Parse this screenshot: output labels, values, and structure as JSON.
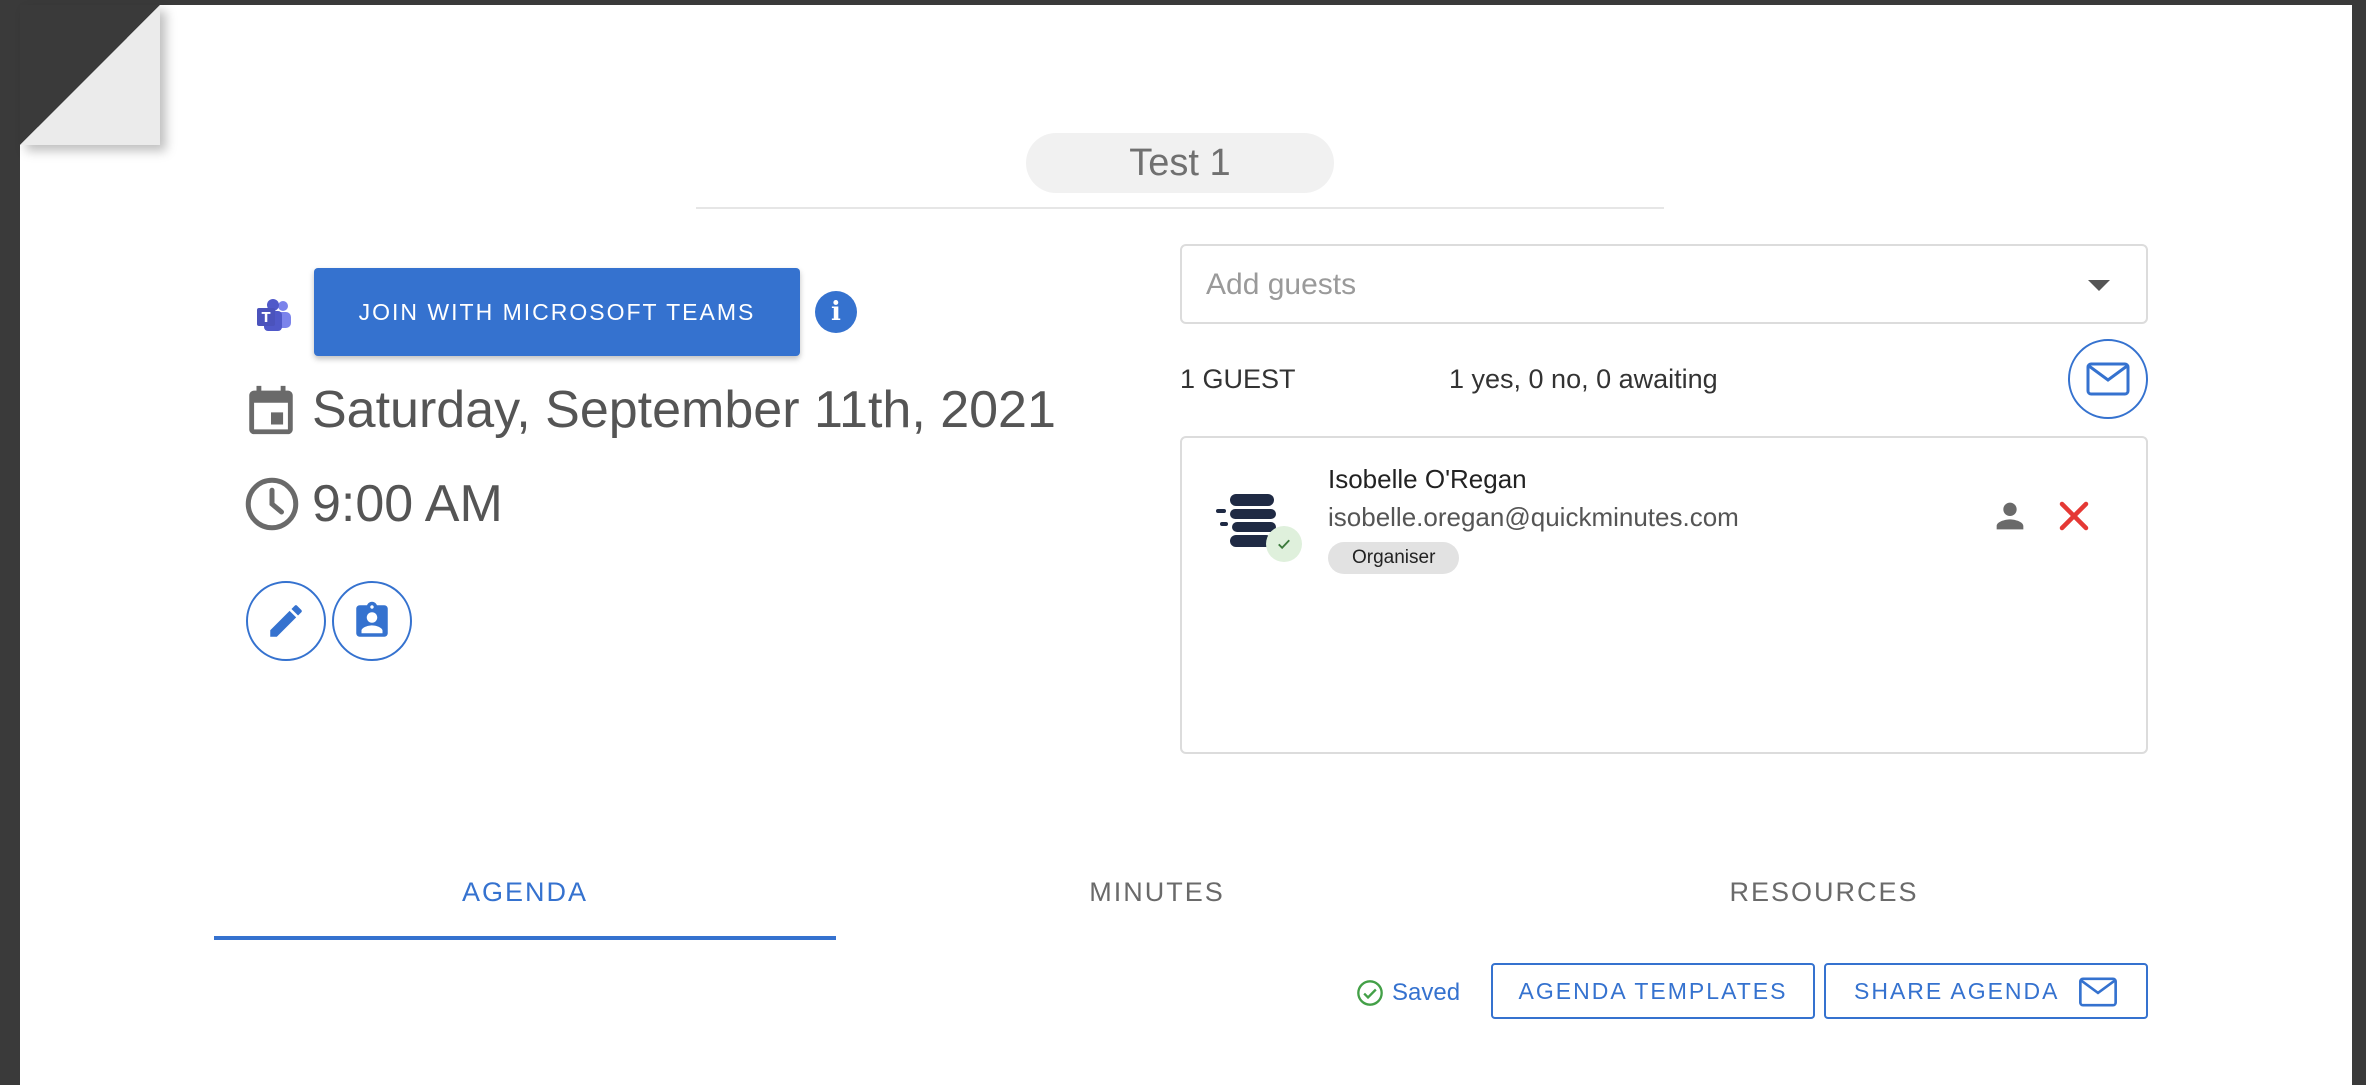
{
  "meeting": {
    "title": "Test 1",
    "join_label": "JOIN WITH MICROSOFT TEAMS",
    "date": "Saturday, September 11th, 2021",
    "time": "9:00 AM"
  },
  "guests": {
    "placeholder": "Add guests",
    "count_label": "1 GUEST",
    "summary": "1 yes, 0 no, 0 awaiting",
    "list": [
      {
        "name": "Isobelle O'Regan",
        "email": "isobelle.oregan@quickminutes.com",
        "role": "Organiser"
      }
    ]
  },
  "tabs": {
    "agenda": "AGENDA",
    "minutes": "MINUTES",
    "resources": "RESOURCES"
  },
  "toolbar": {
    "saved": "Saved",
    "agenda_templates": "AGENDA TEMPLATES",
    "share_agenda": "SHARE AGENDA"
  },
  "colors": {
    "accent": "#3572cf",
    "remove": "#e53935",
    "saved_check": "#43a047"
  },
  "icons": {
    "teams": "microsoft-teams-icon",
    "info": "info-icon",
    "calendar": "calendar-icon",
    "clock": "clock-icon",
    "edit": "pencil-icon",
    "contact": "contact-card-icon",
    "mail": "mail-icon",
    "person": "person-icon",
    "remove": "close-icon",
    "saved": "check-circle-icon",
    "dropdown": "chevron-down-icon"
  }
}
